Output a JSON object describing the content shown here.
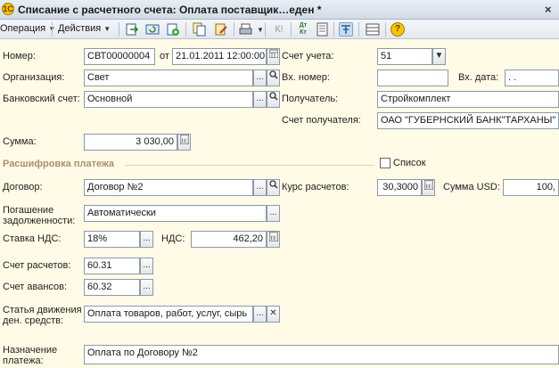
{
  "window": {
    "title": "Списание с расчетного счета: Оплата поставщик…еден *",
    "app_icon": "1С"
  },
  "toolbar": {
    "operation_label": "Операция",
    "actions_label": "Действия",
    "kl_label": "К!",
    "dt_kt_label": "Дт Кт",
    "help_label": "?"
  },
  "form": {
    "number": {
      "label": "Номер:",
      "value": "СВТ00000004"
    },
    "date": {
      "label": "от",
      "value": "21.01.2011 12:00:00"
    },
    "account": {
      "label": "Счет учета:",
      "value": "51"
    },
    "organization": {
      "label": "Организация:",
      "value": "Свет"
    },
    "incoming_number": {
      "label": "Вх. номер:",
      "value": ""
    },
    "incoming_date": {
      "label": "Вх. дата:",
      "value": ". ."
    },
    "bank_account": {
      "label": "Банковский счет:",
      "value": "Основной"
    },
    "recipient": {
      "label": "Получатель:",
      "value": "Стройкомплект"
    },
    "recipient_account": {
      "label": "Счет получателя:",
      "value": "ОАО \"ГУБЕРНСКИЙ БАНК\"ТАРХАНЫ\""
    },
    "amount": {
      "label": "Сумма:",
      "value": "3 030,00"
    },
    "section_title": "Расшифровка платежа",
    "list_checkbox_label": "Список",
    "contract": {
      "label": "Договор:",
      "value": "Договор №2"
    },
    "rate": {
      "label": "Курс расчетов:",
      "value": "30,3000"
    },
    "usd_sum": {
      "label": "Сумма USD:",
      "value": "100,"
    },
    "debt_repayment": {
      "label": "Погашение задолженности:",
      "value": "Автоматически"
    },
    "vat_rate": {
      "label": "Ставка НДС:",
      "value": "18%"
    },
    "vat": {
      "label": "НДС:",
      "value": "462,20"
    },
    "settlement_account": {
      "label": "Счет расчетов:",
      "value": "60.31"
    },
    "advance_account": {
      "label": "Счет авансов:",
      "value": "60.32"
    },
    "cash_flow_item": {
      "label": "Статья движения ден. средств:",
      "value": "Оплата товаров, работ, услуг, сырь"
    },
    "payment_purpose": {
      "label": "Назначение платежа:",
      "value": "Оплата по Договору №2"
    }
  },
  "colors": {
    "form_bg": "#fffbe6",
    "section_title": "#a89070",
    "field_border": "#8c9aaa"
  }
}
